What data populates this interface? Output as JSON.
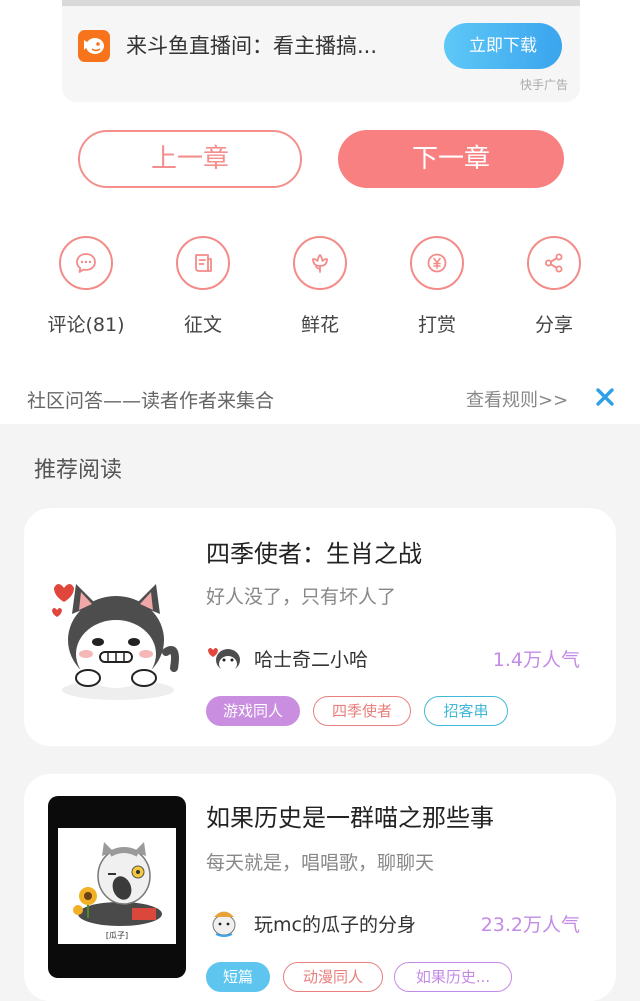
{
  "ad": {
    "text": "来斗鱼直播间：看主播搞...",
    "button": "立即下载",
    "source": "快手广告",
    "icon": "douyu-fish-icon"
  },
  "chapter_nav": {
    "prev": "上一章",
    "next": "下一章"
  },
  "actions": [
    {
      "label": "评论(81)",
      "icon": "comment-icon"
    },
    {
      "label": "征文",
      "icon": "contest-icon"
    },
    {
      "label": "鲜花",
      "icon": "flower-icon"
    },
    {
      "label": "打赏",
      "icon": "reward-icon"
    },
    {
      "label": "分享",
      "icon": "share-icon"
    }
  ],
  "community": {
    "text": "社区问答——读者作者来集合",
    "rules": "查看规则>>",
    "close_icon": "close-icon"
  },
  "recommend": {
    "title": "推荐阅读",
    "books": [
      {
        "title": "四季使者：生肖之战",
        "desc": "好人没了，只有坏人了",
        "author": "哈士奇二小哈",
        "popularity": "1.4万人气",
        "tags": [
          "游戏同人",
          "四季使者",
          "招客串"
        ]
      },
      {
        "title": "如果历史是一群喵之那些事",
        "desc": "每天就是，唱唱歌，聊聊天",
        "author": "玩mc的瓜子的分身",
        "popularity": "23.2万人气",
        "tags": [
          "短篇",
          "动漫同人",
          "如果历史..."
        ],
        "cover_caption": "[瓜子]"
      }
    ]
  },
  "colors": {
    "accent": "#f98080",
    "accent_outline": "#f3908d",
    "popularity": "#c48be6",
    "ad_button": "#3aa4ee"
  }
}
